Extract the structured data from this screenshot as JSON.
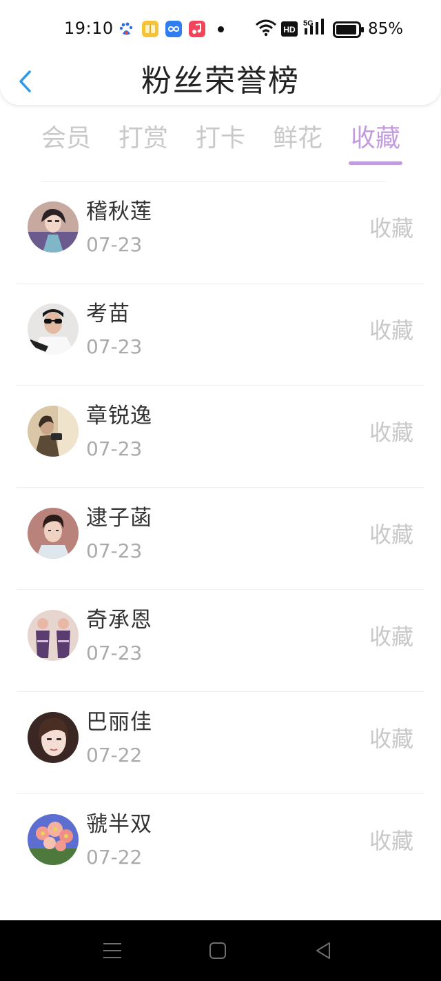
{
  "status_bar": {
    "time": "19:10",
    "battery_percent": "85%",
    "network_label": "5G",
    "hd_label": "HD",
    "app_icons": [
      "baidu-icon",
      "notes-icon",
      "loop-app-icon",
      "music-icon"
    ]
  },
  "header": {
    "title": "粉丝荣誉榜",
    "back_icon": "chevron-left-icon"
  },
  "tabs": [
    {
      "label": "会员",
      "active": false
    },
    {
      "label": "打赏",
      "active": false
    },
    {
      "label": "打卡",
      "active": false
    },
    {
      "label": "鲜花",
      "active": false
    },
    {
      "label": "收藏",
      "active": true
    }
  ],
  "colors": {
    "accent": "#c39ce0",
    "back_icon": "#2f9be8",
    "inactive_tab": "#c9c9c9"
  },
  "list": {
    "items": [
      {
        "name": "稽秋莲",
        "date": "07-23",
        "action": "收藏"
      },
      {
        "name": "考苗",
        "date": "07-23",
        "action": "收藏"
      },
      {
        "name": "章锐逸",
        "date": "07-23",
        "action": "收藏"
      },
      {
        "name": "逮子菡",
        "date": "07-23",
        "action": "收藏"
      },
      {
        "name": "奇承恩",
        "date": "07-23",
        "action": "收藏"
      },
      {
        "name": "巴丽佳",
        "date": "07-22",
        "action": "收藏"
      },
      {
        "name": "虢半双",
        "date": "07-22",
        "action": "收藏"
      }
    ]
  },
  "nav_bar": {
    "buttons": [
      "menu-icon",
      "home-icon",
      "back-triangle-icon"
    ]
  }
}
